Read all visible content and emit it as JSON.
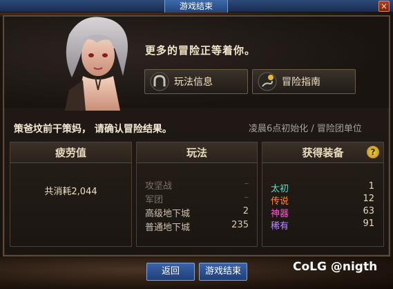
{
  "window": {
    "title": "游戏结束",
    "close_label": "×"
  },
  "npc": {
    "headline": "更多的冒险正等着你。"
  },
  "actions": {
    "play_info_label": "玩法信息",
    "guide_label": "冒险指南"
  },
  "confirm": {
    "message": "策爸坟前干策妈， 请确认冒险结果。",
    "reset_note": "凌晨6点初始化 / 冒险团单位"
  },
  "fatigue": {
    "title": "疲劳值",
    "total_label": "共消耗2,044"
  },
  "play": {
    "title": "玩法",
    "rows": [
      {
        "label": "攻坚战",
        "value": "–",
        "dim": true
      },
      {
        "label": "军团",
        "value": "–",
        "dim": true
      },
      {
        "label": "高级地下城",
        "value": "2",
        "dim": false
      },
      {
        "label": "普通地下城",
        "value": "235",
        "dim": false
      }
    ]
  },
  "gear": {
    "title": "获得装备",
    "help_label": "?",
    "rows": [
      {
        "label": "太初",
        "value": "1",
        "color": "#5fe0c8"
      },
      {
        "label": "传说",
        "value": "12",
        "color": "#ff8a2a"
      },
      {
        "label": "神器",
        "value": "63",
        "color": "#ff55d2"
      },
      {
        "label": "稀有",
        "value": "91",
        "color": "#b98cff"
      }
    ]
  },
  "bottom": {
    "back_label": "返回",
    "end_label": "游戏结束"
  },
  "watermark": {
    "text": "CoLG @nigth"
  }
}
